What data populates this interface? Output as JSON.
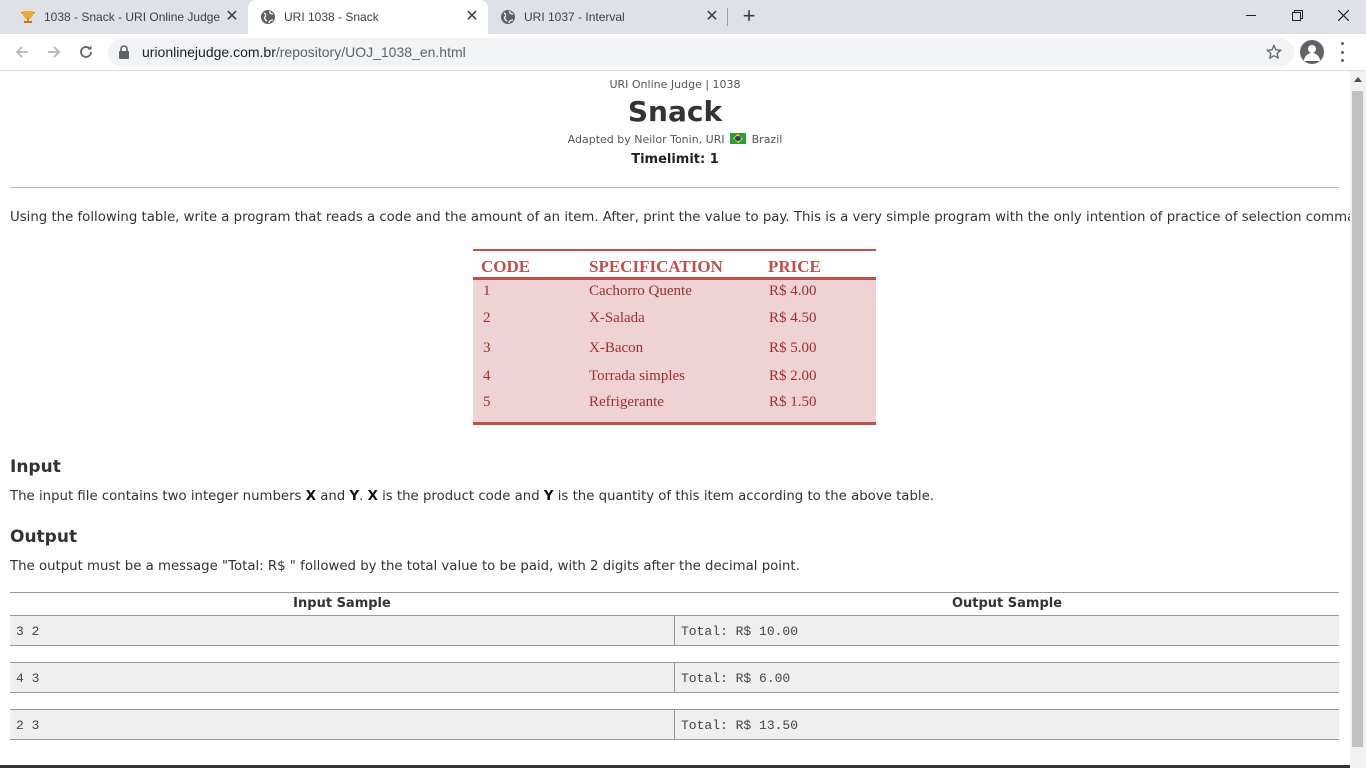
{
  "browser": {
    "tabs": [
      {
        "title": "1038 - Snack - URI Online Judge",
        "icon": "trophy-icon",
        "active": false
      },
      {
        "title": "URI 1038 - Snack",
        "icon": "globe-icon",
        "active": true
      },
      {
        "title": "URI 1037 - Interval",
        "icon": "globe-icon",
        "active": false
      }
    ],
    "new_tab_label": "+",
    "close_glyph": "✕",
    "url_host": "urionlinejudge.com.br",
    "url_path": "/repository/UOJ_1038_en.html"
  },
  "page": {
    "site_line": "URI Online Judge | 1038",
    "title": "Snack",
    "adapted_prefix": "Adapted by Neilor Tonin, URI",
    "adapted_country": "Brazil",
    "timelimit": "Timelimit: 1",
    "intro": "Using the following table, write a program that reads a code and the amount of an item. After, print the value to pay. This is a very simple program with the only intention of practice of selection commands.",
    "menu_table": {
      "headers": [
        "CODE",
        "SPECIFICATION",
        "PRICE"
      ],
      "rows": [
        [
          "1",
          "Cachorro Quente",
          "R$ 4.00"
        ],
        [
          "2",
          "X-Salada",
          "R$ 4.50"
        ],
        [
          "3",
          "X-Bacon",
          "R$ 5.00"
        ],
        [
          "4",
          "Torrada simples",
          "R$ 2.00"
        ],
        [
          "5",
          "Refrigerante",
          "R$ 1.50"
        ]
      ]
    },
    "input": {
      "heading": "Input",
      "p1": "The input file contains two integer numbers ",
      "x": "X",
      "and": " and ",
      "y": "Y",
      "dot": ". ",
      "x2": "X",
      "p2": " is the product code and ",
      "y2": "Y",
      "p3": " is the quantity of this item according to the above table."
    },
    "output": {
      "heading": "Output",
      "text": "The output must be a message \"Total: R$ \" followed by the total value to be paid, with 2 digits after the decimal point."
    },
    "samples": {
      "input_header": "Input Sample",
      "output_header": "Output Sample",
      "rows": [
        {
          "input": "3 2",
          "output": "Total: R$ 10.00"
        },
        {
          "input": "4 3",
          "output": "Total: R$ 6.00"
        },
        {
          "input": "2 3",
          "output": "Total: R$ 13.50"
        }
      ]
    }
  },
  "colors": {
    "table_accent": "#c0504d",
    "table_fill": "#efd3d4"
  }
}
